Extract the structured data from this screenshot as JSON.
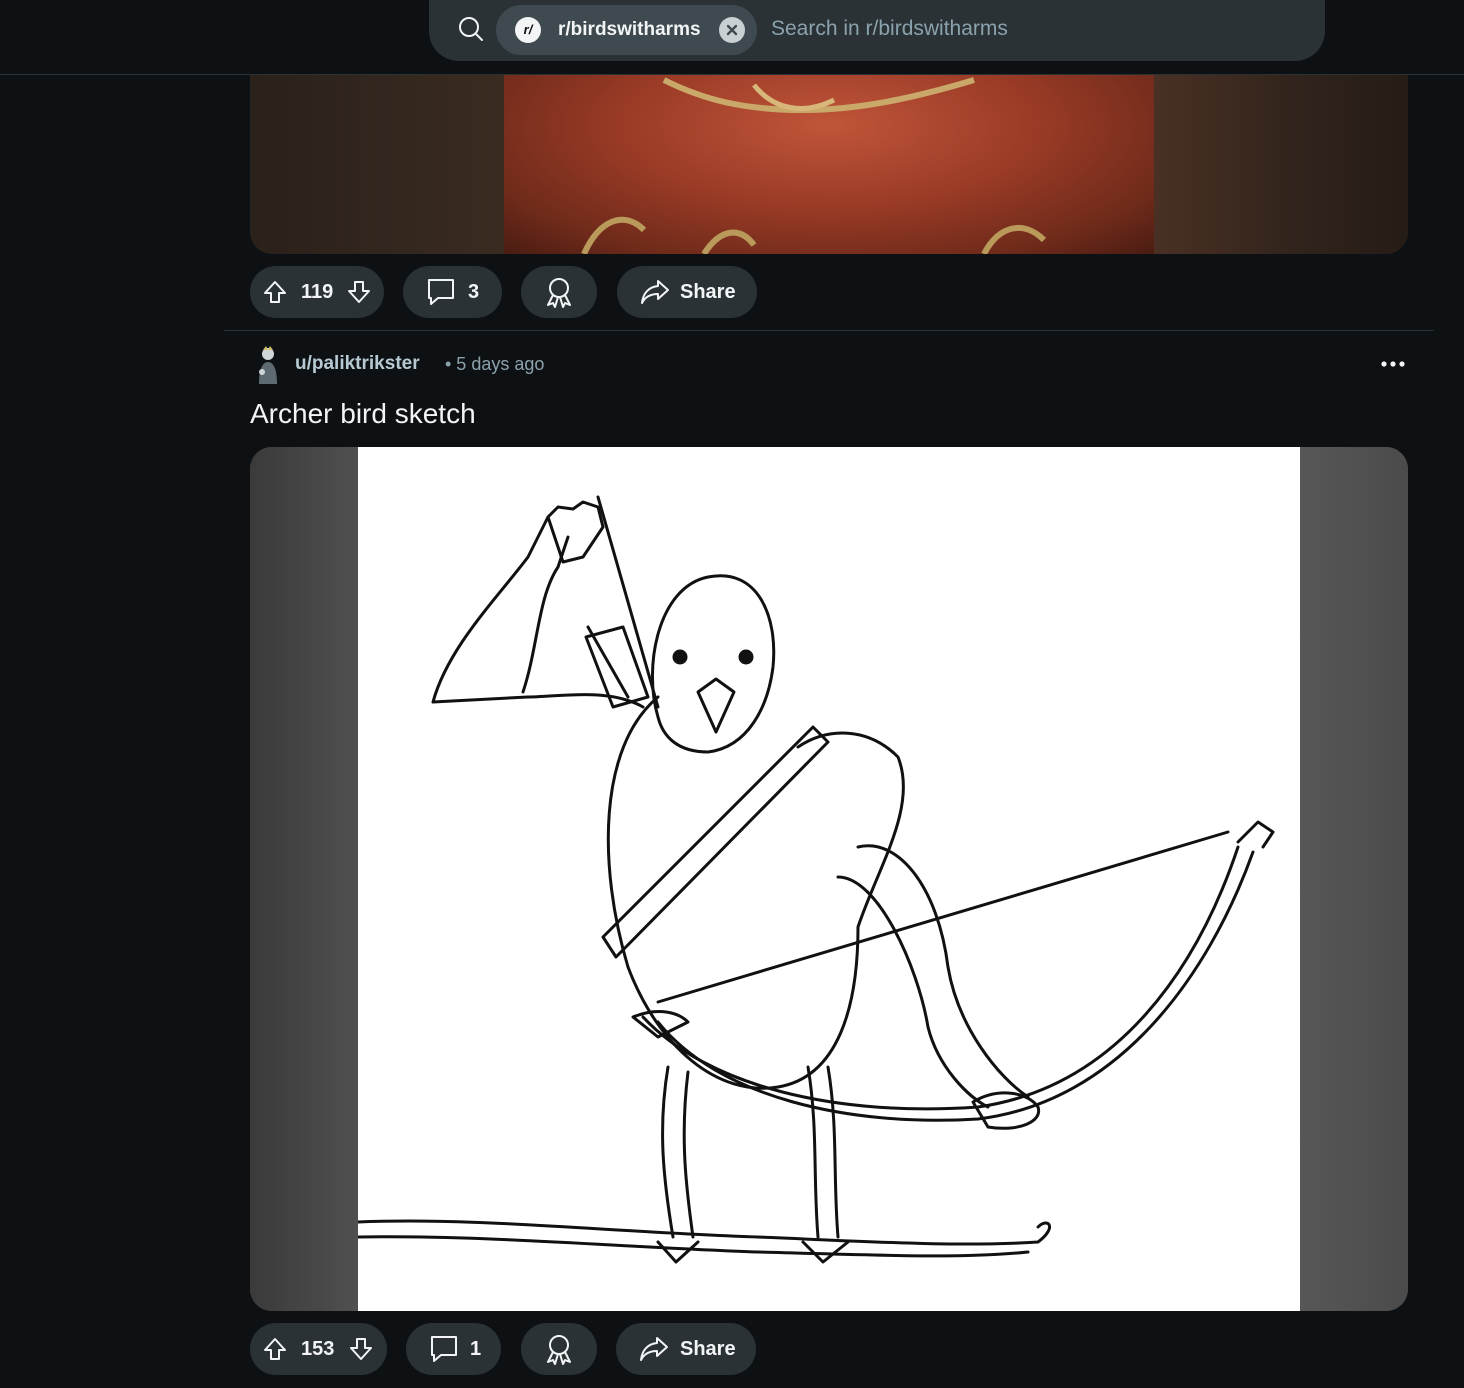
{
  "search": {
    "chip_avatar": "r/",
    "chip_label": "r/birdswitharms",
    "placeholder": "Search in r/birdswitharms"
  },
  "prev_post": {
    "votes": "119",
    "comments": "3",
    "share_label": "Share"
  },
  "post": {
    "author": "u/paliktrikster",
    "time": "• 5 days ago",
    "title": "Archer bird sketch",
    "votes": "153",
    "comments": "1",
    "share_label": "Share"
  },
  "colors": {
    "background": "#0e1113",
    "pill": "#2a3236",
    "chip": "#3e4a50",
    "muted_text": "#8ba2ad"
  },
  "icons": [
    "search-icon",
    "subreddit-icon",
    "close-icon",
    "upvote-icon",
    "downvote-icon",
    "comment-icon",
    "award-icon",
    "share-icon",
    "more-icon"
  ]
}
